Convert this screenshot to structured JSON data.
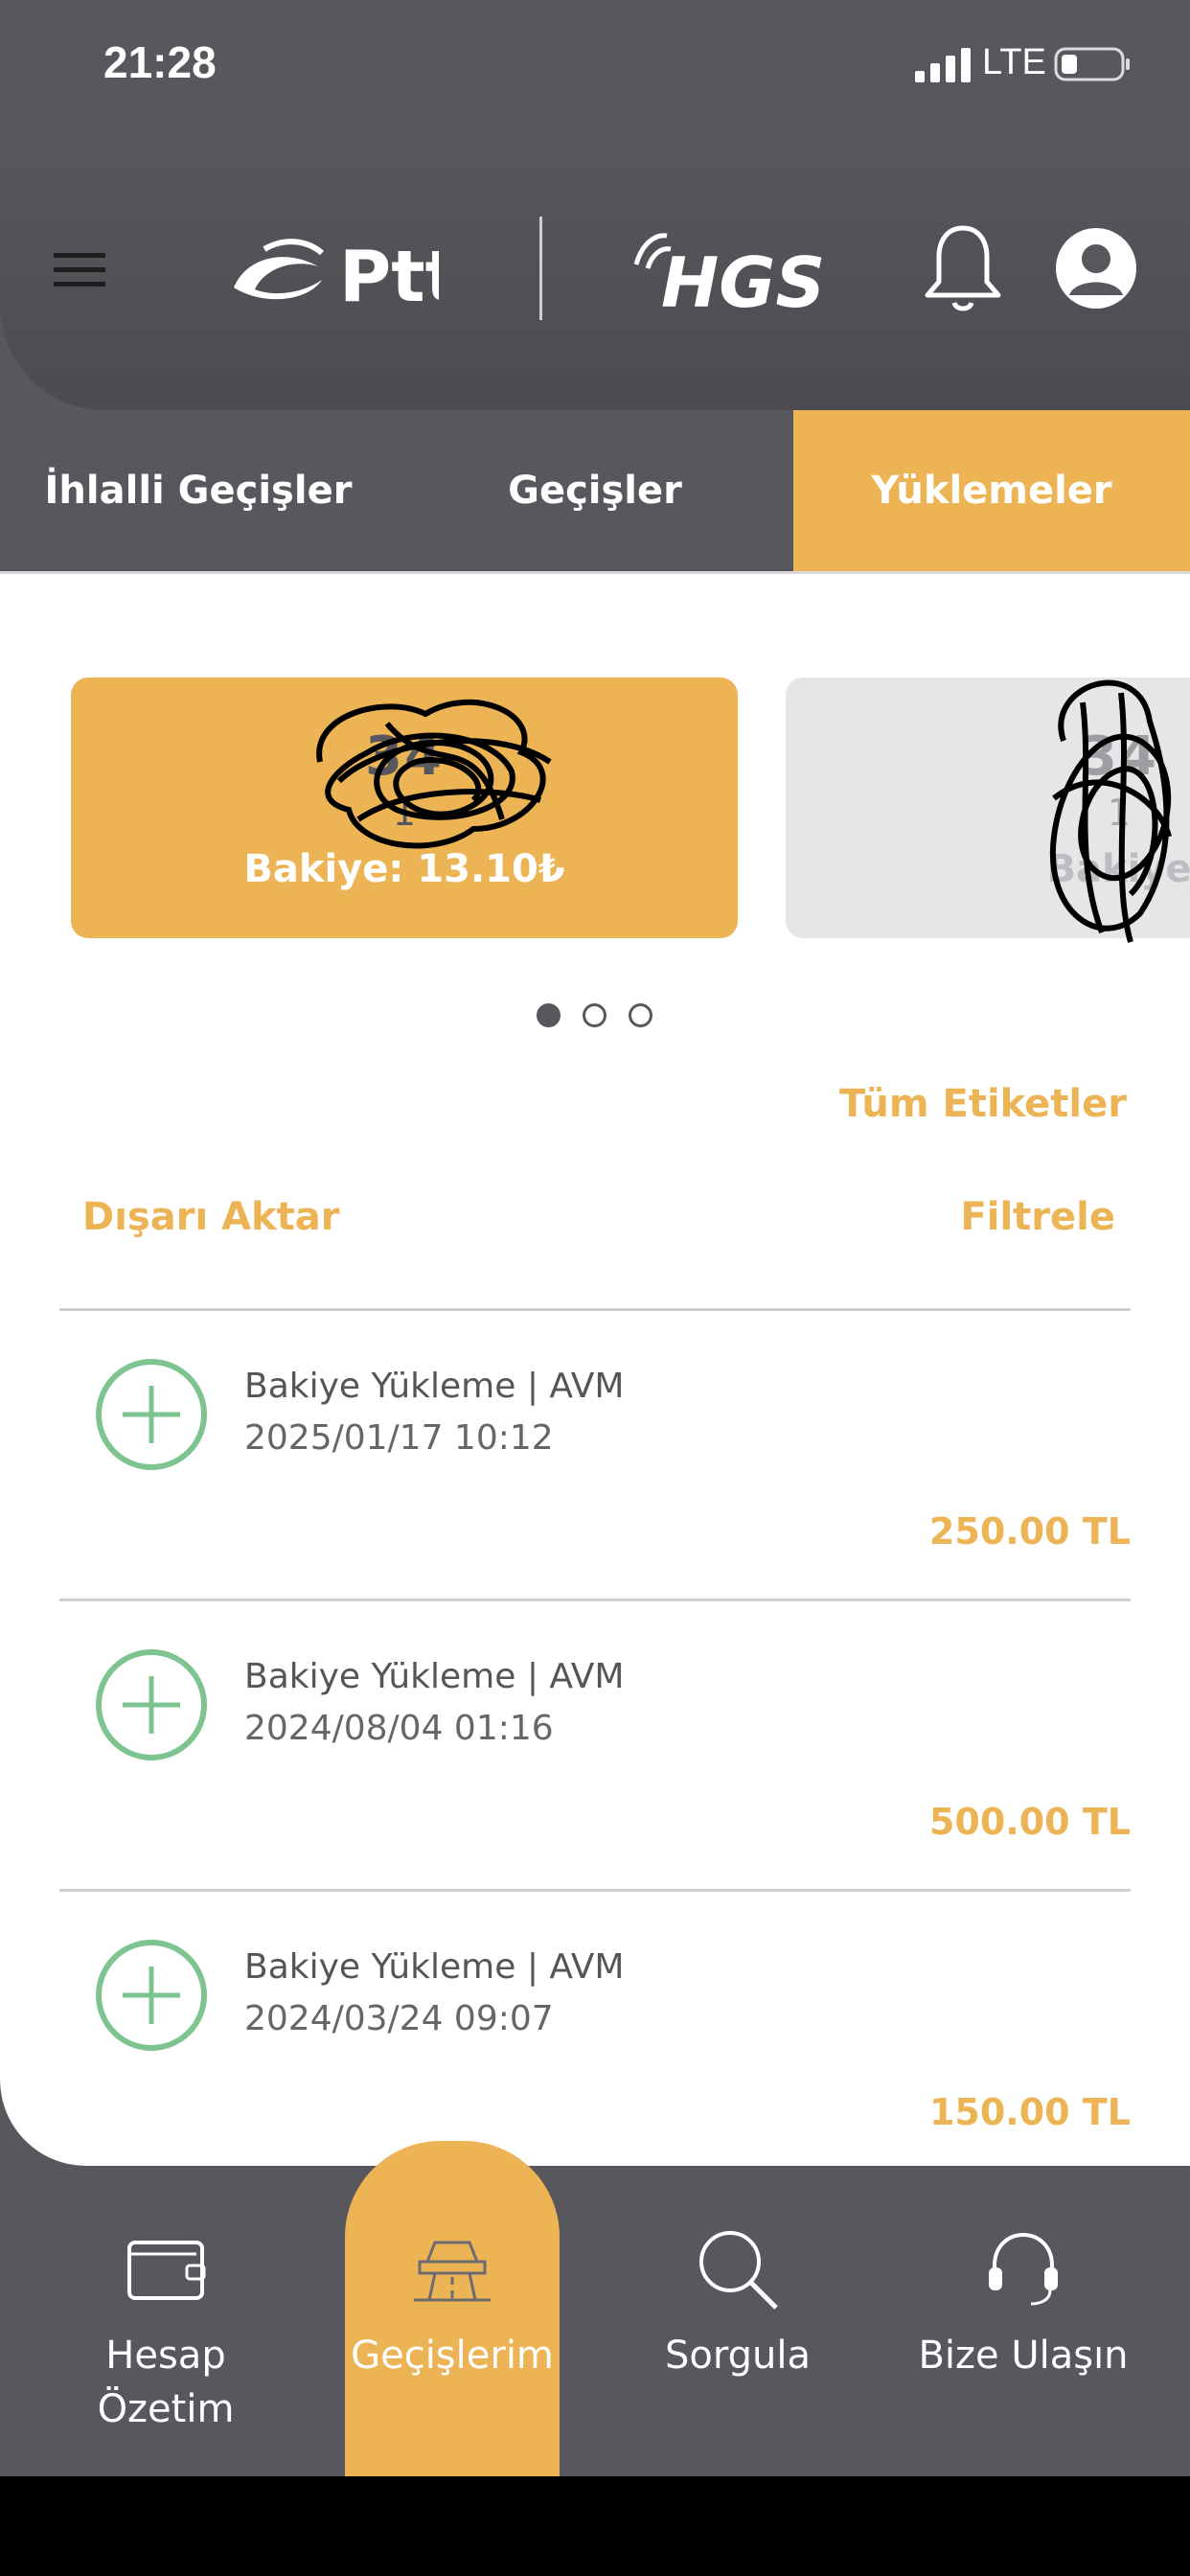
{
  "status_bar": {
    "time": "21:28",
    "network": "LTE"
  },
  "header": {
    "ptt_logo_text": "Ptt",
    "hgs_logo_text": "HGS"
  },
  "tabs": [
    {
      "label": "İhlalli Geçişler",
      "active": false
    },
    {
      "label": "Geçişler",
      "active": false
    },
    {
      "label": "Yüklemeler",
      "active": true
    }
  ],
  "cards": [
    {
      "plate": "34",
      "sub": "1",
      "balance": "Bakiye: 13.10₺"
    },
    {
      "plate": "34",
      "sub": "1",
      "balance": "Bakiye"
    }
  ],
  "carousel": {
    "pages": 3,
    "active_page": 1
  },
  "actions": {
    "all_tags": "Tüm Etiketler",
    "export": "Dışarı Aktar",
    "filter": "Filtrele"
  },
  "transactions": [
    {
      "title": "Bakiye Yükleme | AVM",
      "date": "2025/01/17 10:12",
      "amount": "250.00 TL"
    },
    {
      "title": "Bakiye Yükleme | AVM",
      "date": "2024/08/04 01:16",
      "amount": "500.00 TL"
    },
    {
      "title": "Bakiye Yükleme | AVM",
      "date": "2024/03/24 09:07",
      "amount": "150.00 TL"
    }
  ],
  "bottom_nav": [
    {
      "label": "Hesap Özetim",
      "icon": "wallet-icon",
      "active": false
    },
    {
      "label": "Geçişlerim",
      "icon": "toll-gate-icon",
      "active": true
    },
    {
      "label": "Sorgula",
      "icon": "search-icon",
      "active": false
    },
    {
      "label": "Bize Ulaşın",
      "icon": "headset-icon",
      "active": false
    }
  ],
  "colors": {
    "accent": "#ecb454",
    "dark": "#58575d",
    "success": "#7ec490"
  }
}
